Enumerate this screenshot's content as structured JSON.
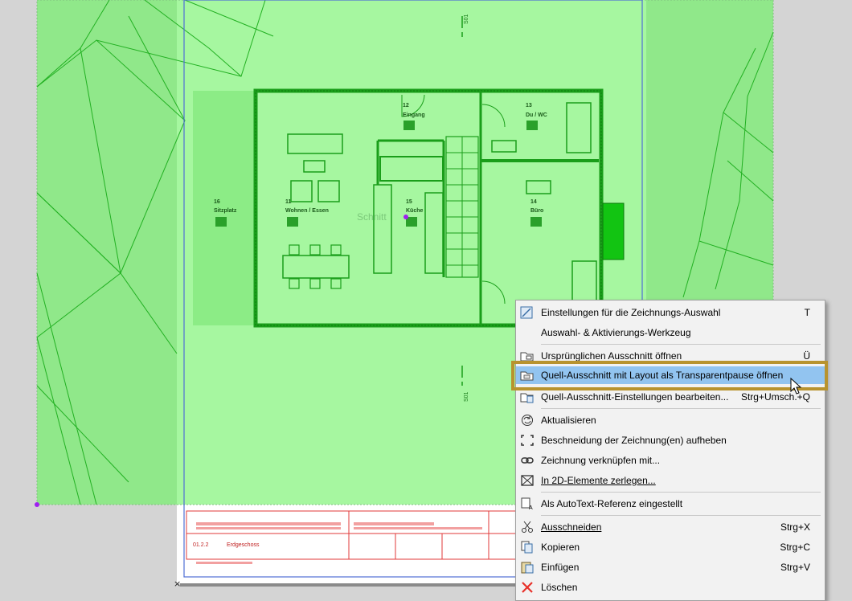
{
  "drawing": {
    "room_labels": [
      {
        "num": "12",
        "name": "Eingang"
      },
      {
        "num": "13",
        "name": "Du / WC"
      },
      {
        "num": "16",
        "name": "Sitzplatz"
      },
      {
        "num": "11",
        "name": "Wohnen / Essen"
      },
      {
        "num": "15",
        "name": "Küche"
      },
      {
        "num": "14",
        "name": "Büro"
      }
    ],
    "section_label_top": "S01",
    "section_label_bottom": "S01",
    "watermark": "Schnitt",
    "title_block": {
      "drawing_id": "01.2.2",
      "drawing_name": "Erdgeschoss"
    }
  },
  "context_menu": {
    "items": [
      {
        "label": "Einstellungen für die Zeichnungs-Auswahl",
        "shortcut": "T",
        "icon": "drawing-settings-icon"
      },
      {
        "label": "Auswahl- & Aktivierungs-Werkzeug",
        "shortcut": "",
        "icon": ""
      },
      {
        "label": "Ursprünglichen Ausschnitt öffnen",
        "shortcut": "Ü",
        "icon": "open-source-view-icon"
      },
      {
        "label": "Quell-Ausschnitt mit Layout als Transparentpause öffnen",
        "shortcut": "",
        "icon": "open-trace-icon"
      },
      {
        "label": "Quell-Ausschnitt-Einstellungen bearbeiten...",
        "shortcut": "Strg+Umsch.+Q",
        "icon": "view-settings-icon"
      },
      {
        "label": "Aktualisieren",
        "shortcut": "",
        "icon": "refresh-icon"
      },
      {
        "label": "Beschneidung der Zeichnung(en) aufheben",
        "shortcut": "",
        "icon": "crop-icon"
      },
      {
        "label": "Zeichnung verknüpfen mit...",
        "shortcut": "",
        "icon": "link-icon"
      },
      {
        "label": "In 2D-Elemente zerlegen...",
        "shortcut": "",
        "icon": "explode-icon"
      },
      {
        "label": "Als AutoText-Referenz eingestellt",
        "shortcut": "",
        "icon": "autotext-icon"
      },
      {
        "label": "Ausschneiden",
        "shortcut": "Strg+X",
        "icon": "scissors-icon"
      },
      {
        "label": "Kopieren",
        "shortcut": "Strg+C",
        "icon": "copy-icon"
      },
      {
        "label": "Einfügen",
        "shortcut": "Strg+V",
        "icon": "paste-icon"
      },
      {
        "label": "Löschen",
        "shortcut": "",
        "icon": "delete-icon"
      }
    ],
    "highlighted_index": 3
  },
  "colors": {
    "canvas_bg": "#d4d4d4",
    "drawing_fill": "#a6f7a0",
    "drawing_fill_dark": "#90e88a",
    "drawing_line": "#1fae1f",
    "highlight": "#92c4f0",
    "focus_border": "#b8932e",
    "titleblock_red": "#e23a3a",
    "delete_red": "#e8312a",
    "selection_purple": "#a020f0",
    "layout_border": "#4f6fd6"
  }
}
